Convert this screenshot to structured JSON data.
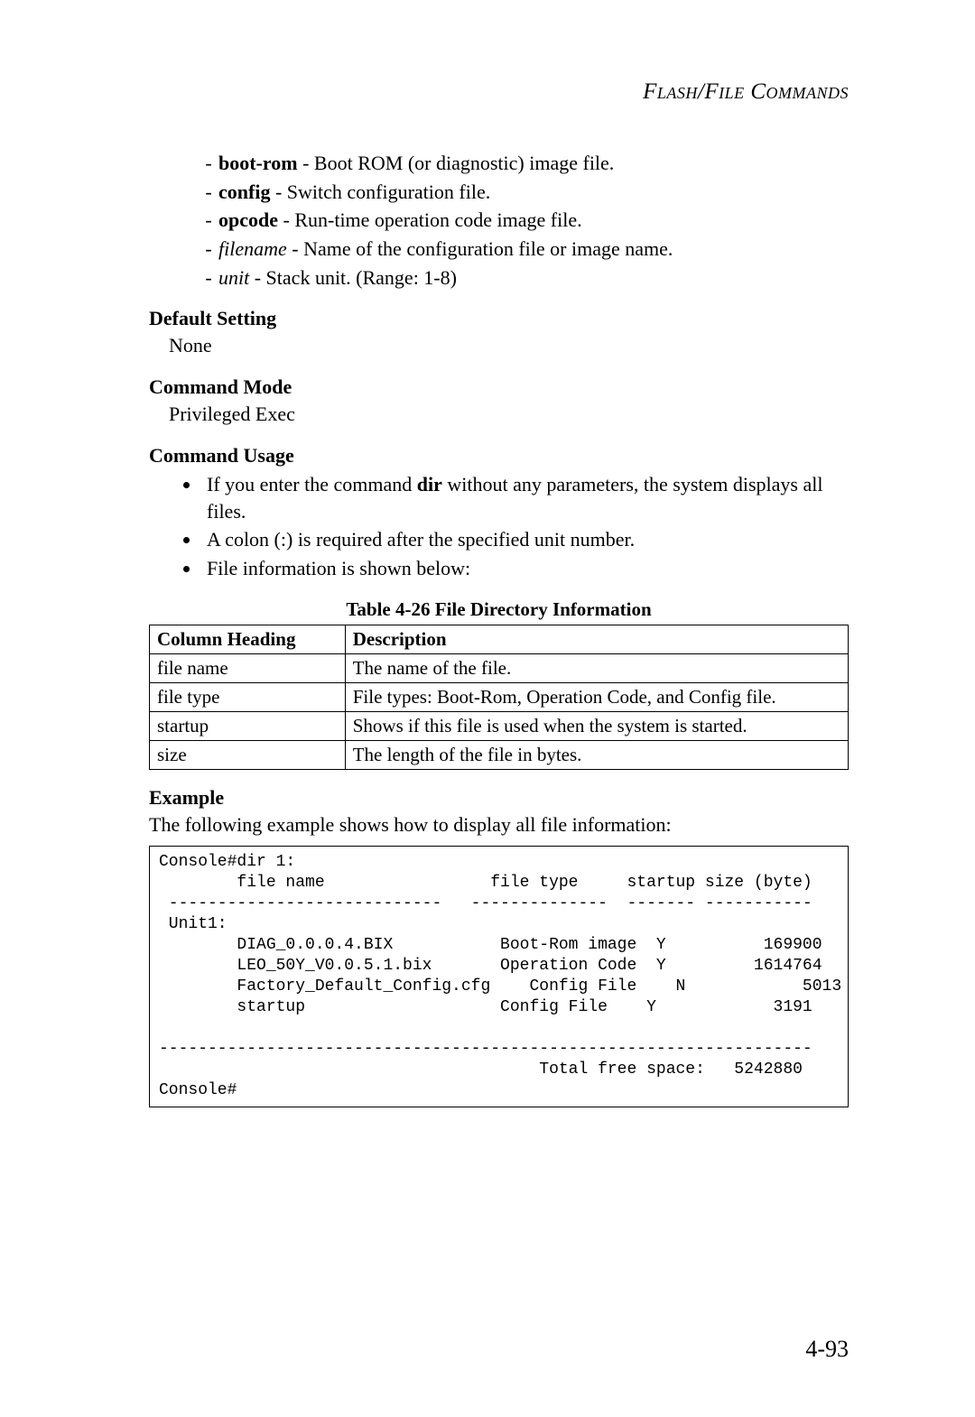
{
  "header": "Flash/File Commands",
  "defs": [
    {
      "term": "boot-rom",
      "style": "bold",
      "desc": " - Boot ROM (or diagnostic) image file."
    },
    {
      "term": "config",
      "style": "bold",
      "desc": " - Switch configuration file."
    },
    {
      "term": "opcode",
      "style": "bold",
      "desc": " - Run-time operation code image file."
    },
    {
      "term": "filename",
      "style": "ital",
      "desc": " - Name of the configuration file or image name."
    },
    {
      "term": "unit",
      "style": "ital",
      "desc": " - Stack unit. (Range: 1-8)"
    }
  ],
  "sections": {
    "default_setting": {
      "heading": "Default Setting",
      "body": "None"
    },
    "command_mode": {
      "heading": "Command Mode",
      "body": "Privileged Exec"
    },
    "command_usage": {
      "heading": "Command Usage",
      "items_pre": "If you enter the command ",
      "items_bold": "dir",
      "items_post": " without any parameters, the system displays all files.",
      "item2": "A colon (:) is required after the specified unit number.",
      "item3": "File information is shown below:"
    },
    "example": {
      "heading": "Example",
      "intro": "The following example shows how to display all file information:"
    }
  },
  "table": {
    "caption": "Table 4-26  File Directory Information",
    "header": {
      "col1": "Column Heading",
      "col2": "Description"
    },
    "rows": [
      {
        "c1": "file name",
        "c2": "The name of the file."
      },
      {
        "c1": "file type",
        "c2": "File types: Boot-Rom, Operation Code, and Config file."
      },
      {
        "c1": "startup",
        "c2": "Shows if this file is used when the system is started."
      },
      {
        "c1": "size",
        "c2": "The length of the file in bytes."
      }
    ]
  },
  "console": "Console#dir 1:\n        file name                 file type     startup size (byte)\n ----------------------------   --------------  ------- -----------\n Unit1:\n        DIAG_0.0.0.4.BIX           Boot-Rom image  Y          169900\n        LEO_50Y_V0.0.5.1.bix       Operation Code  Y         1614764\n        Factory_Default_Config.cfg    Config File    N            5013\n        startup                    Config File    Y            3191\n\n-------------------------------------------------------------------\n                                       Total free space:   5242880\nConsole#",
  "page_number": "4-93"
}
